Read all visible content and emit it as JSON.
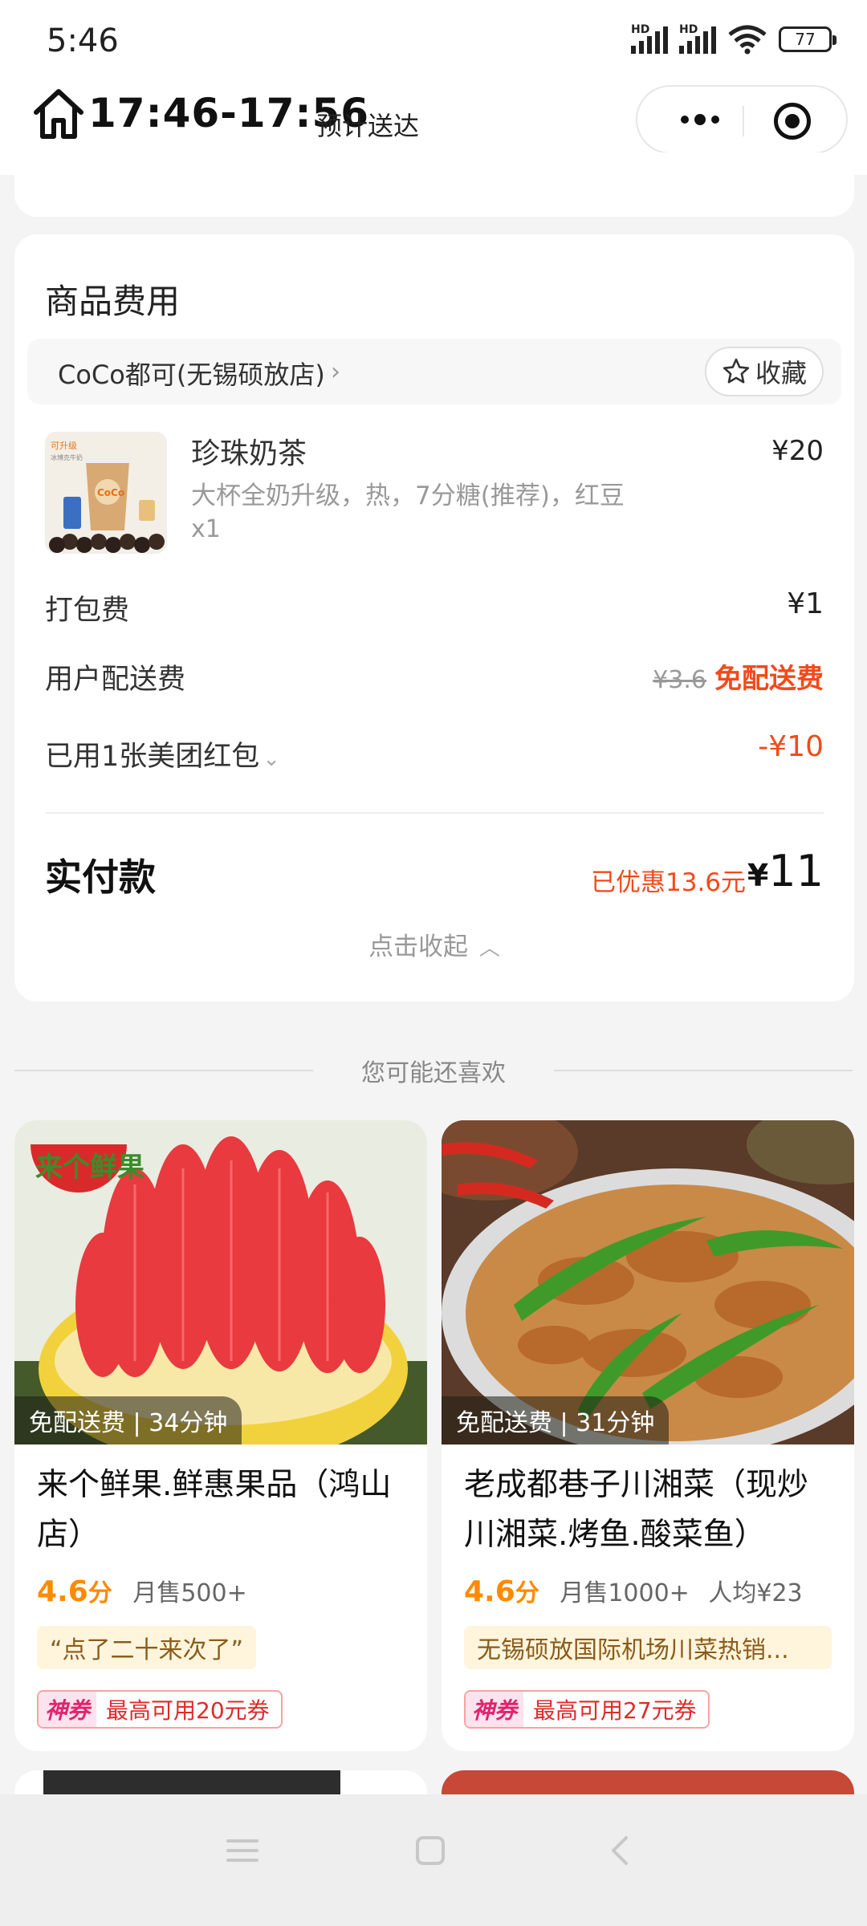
{
  "status_bar": {
    "time": "5:46",
    "battery": "77",
    "hd1": "HD",
    "hd2": "HD"
  },
  "header": {
    "eta": "17:46-17:56",
    "eta_label": "预计送达"
  },
  "fee_card": {
    "title": "商品费用",
    "store_name": "CoCo都可(无锡硕放店)",
    "store_arrow": "›",
    "favorite_label": "收藏",
    "item": {
      "name": "珍珠奶茶",
      "spec": "大杯全奶升级，热，7分糖(推荐)，红豆",
      "qty": "x1",
      "price": "¥20",
      "thumb_text_top": "可升级",
      "thumb_text_sub": "冰博克牛奶",
      "thumb_brand": "CoCo"
    },
    "packing_label": "打包费",
    "packing_value": "¥1",
    "delivery_label": "用户配送费",
    "delivery_original": "¥3.6",
    "delivery_value": "免配送费",
    "coupon_label": "已用1张美团红包",
    "coupon_value": "-¥10",
    "paid_label": "实付款",
    "paid_saved": "已优惠13.6元",
    "paid_currency": "¥",
    "paid_amount": "11",
    "collapse_label": "点击收起"
  },
  "recommend": {
    "title": "您可能还喜欢",
    "cards": [
      {
        "logo_text": "来个鲜果",
        "tag": "免配送费 | 34分钟",
        "name": "来个鲜果.鲜惠果品（鸿山店）",
        "score": "4.6",
        "score_unit": "分",
        "monthly": "月售500+",
        "avg": "",
        "review": "“点了二十来次了”",
        "coupon_badge": "神券",
        "coupon_text": "最高可用20元券"
      },
      {
        "tag": "免配送费 | 31分钟",
        "name": "老成都巷子川湘菜（现炒川湘菜.烤鱼.酸菜鱼）",
        "score": "4.6",
        "score_unit": "分",
        "monthly": "月售1000+",
        "avg": "人均¥23",
        "review": "无锡硕放国际机场川菜热销...",
        "coupon_badge": "神券",
        "coupon_text": "最高可用27元券"
      }
    ]
  },
  "colors": {
    "accent_red": "#f24a1a",
    "score_orange": "#ff8a00"
  }
}
